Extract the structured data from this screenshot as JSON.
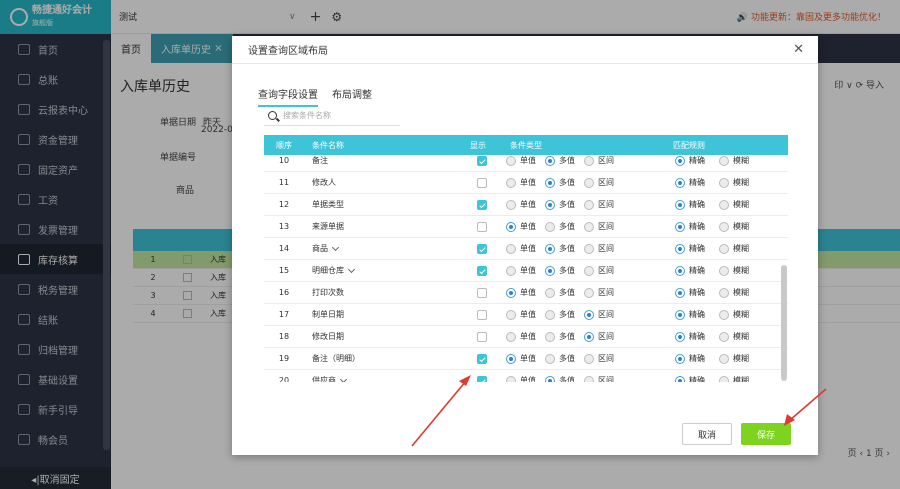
{
  "app": {
    "logo_title": "畅捷通好会计",
    "logo_sub": "旗舰版"
  },
  "sidebar": {
    "items": [
      {
        "label": "首页",
        "icon": "home-icon"
      },
      {
        "label": "总账",
        "icon": "ledger-icon"
      },
      {
        "label": "云报表中心",
        "icon": "chart-icon"
      },
      {
        "label": "资金管理",
        "icon": "money-icon"
      },
      {
        "label": "固定资产",
        "icon": "asset-icon"
      },
      {
        "label": "工资",
        "icon": "salary-icon"
      },
      {
        "label": "发票管理",
        "icon": "invoice-icon"
      },
      {
        "label": "库存核算",
        "icon": "warehouse-icon"
      },
      {
        "label": "税务管理",
        "icon": "tax-icon"
      },
      {
        "label": "结账",
        "icon": "close-book-icon"
      },
      {
        "label": "归档管理",
        "icon": "archive-icon"
      },
      {
        "label": "基础设置",
        "icon": "settings-icon"
      },
      {
        "label": "新手引导",
        "icon": "guide-icon"
      },
      {
        "label": "畅会员",
        "icon": "vip-icon"
      }
    ],
    "active_index": 7,
    "cancel_fix": "◂|取消固定"
  },
  "topbar": {
    "account": "测试",
    "notice": "功能更新：靠固及更多功能优化！"
  },
  "tabs": {
    "home": "首页",
    "current": "入库单历史"
  },
  "page": {
    "title": "入库单历史",
    "filters": {
      "date_label": "单据日期",
      "date_value": "昨天",
      "date_sub": "2022-0",
      "code_label": "单据编号",
      "product_label": "商品"
    },
    "tools": "印 ∨   ⟳ 导入",
    "bg_rows": [
      {
        "no": "1",
        "text": "入库"
      },
      {
        "no": "2",
        "text": "入库"
      },
      {
        "no": "3",
        "text": "入库"
      },
      {
        "no": "4",
        "text": "入库"
      }
    ],
    "pager": "页 ‹ 1  页 ›"
  },
  "modal": {
    "title": "设置查询区域布局",
    "tabs": [
      "查询字段设置",
      "布局调整"
    ],
    "search_placeholder": "搜索条件名称",
    "headers": {
      "no": "顺序",
      "name": "条件名称",
      "show": "显示",
      "type": "条件类型",
      "rule": "匹配规则"
    },
    "type_options": [
      "单值",
      "多值",
      "区间"
    ],
    "rule_options": [
      "精确",
      "模糊"
    ],
    "rows": [
      {
        "no": "10",
        "name": "备注",
        "dropdown": false,
        "show": true,
        "type": 1,
        "rule": 0
      },
      {
        "no": "11",
        "name": "修改人",
        "dropdown": false,
        "show": false,
        "type": 1,
        "rule": 0
      },
      {
        "no": "12",
        "name": "单据类型",
        "dropdown": false,
        "show": true,
        "type": 1,
        "rule": 0
      },
      {
        "no": "13",
        "name": "来源单据",
        "dropdown": false,
        "show": false,
        "type": 0,
        "rule": 0
      },
      {
        "no": "14",
        "name": "商品",
        "dropdown": true,
        "show": true,
        "type": 1,
        "rule": 0
      },
      {
        "no": "15",
        "name": "明细仓库",
        "dropdown": true,
        "show": true,
        "type": 1,
        "rule": 0
      },
      {
        "no": "16",
        "name": "打印次数",
        "dropdown": false,
        "show": false,
        "type": 0,
        "rule": 0
      },
      {
        "no": "17",
        "name": "制单日期",
        "dropdown": false,
        "show": false,
        "type": 2,
        "rule": 0
      },
      {
        "no": "18",
        "name": "修改日期",
        "dropdown": false,
        "show": false,
        "type": 2,
        "rule": 0
      },
      {
        "no": "19",
        "name": "备注（明细）",
        "dropdown": false,
        "show": true,
        "type": 0,
        "rule": 0
      },
      {
        "no": "20",
        "name": "供应商",
        "dropdown": true,
        "show": true,
        "type": 1,
        "rule": 0
      }
    ],
    "cancel_label": "取消",
    "save_label": "保存"
  },
  "colors": {
    "accent": "#3ec4d8",
    "save": "#7ed321",
    "sidebar": "#2c3445",
    "arrow": "#e03a2f"
  }
}
